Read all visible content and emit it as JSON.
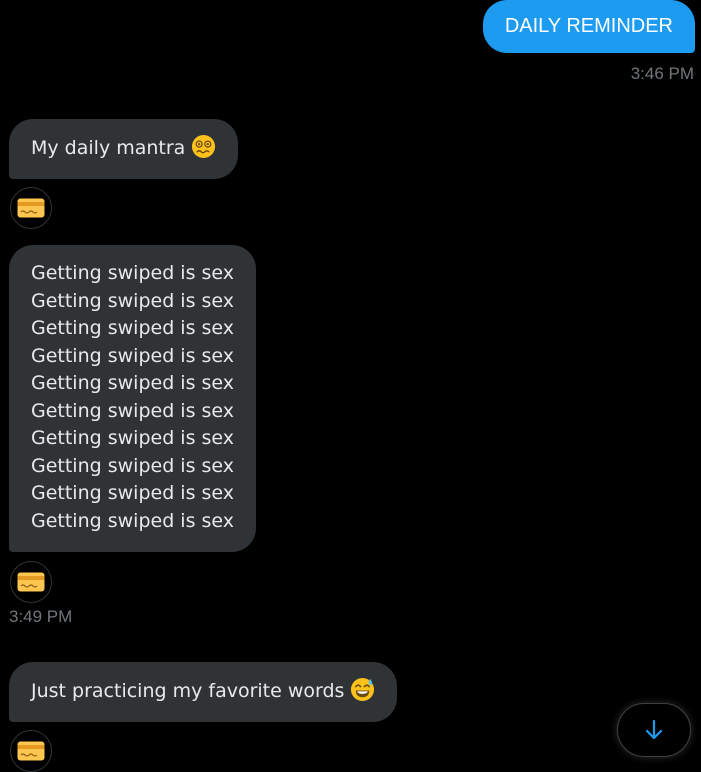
{
  "messages": {
    "out_1": {
      "text": "DAILY REMINDER",
      "time": "3:46 PM"
    },
    "in_1": {
      "text": "My daily mantra",
      "emoji": "woozy-face"
    },
    "in_2": {
      "lines": [
        "Getting swiped is sex",
        "Getting swiped is sex",
        "Getting swiped is sex",
        "Getting swiped is sex",
        "Getting swiped is sex",
        "Getting swiped is sex",
        "Getting swiped is sex",
        "Getting swiped is sex",
        "Getting swiped is sex",
        "Getting swiped is sex"
      ],
      "time": "3:49 PM"
    },
    "in_3": {
      "text": "Just practicing my favorite words",
      "emoji": "grinning-face-with-sweat"
    }
  },
  "reactions": [
    {
      "icon": "credit-card-icon"
    },
    {
      "icon": "credit-card-icon"
    },
    {
      "icon": "credit-card-icon"
    }
  ],
  "scroll_button": {
    "icon": "arrow-down-icon"
  },
  "colors": {
    "background": "#000000",
    "outgoing_bubble": "#1d9bf0",
    "incoming_bubble": "#2f3336",
    "timestamp": "#71767b",
    "accent": "#1d9bf0"
  }
}
